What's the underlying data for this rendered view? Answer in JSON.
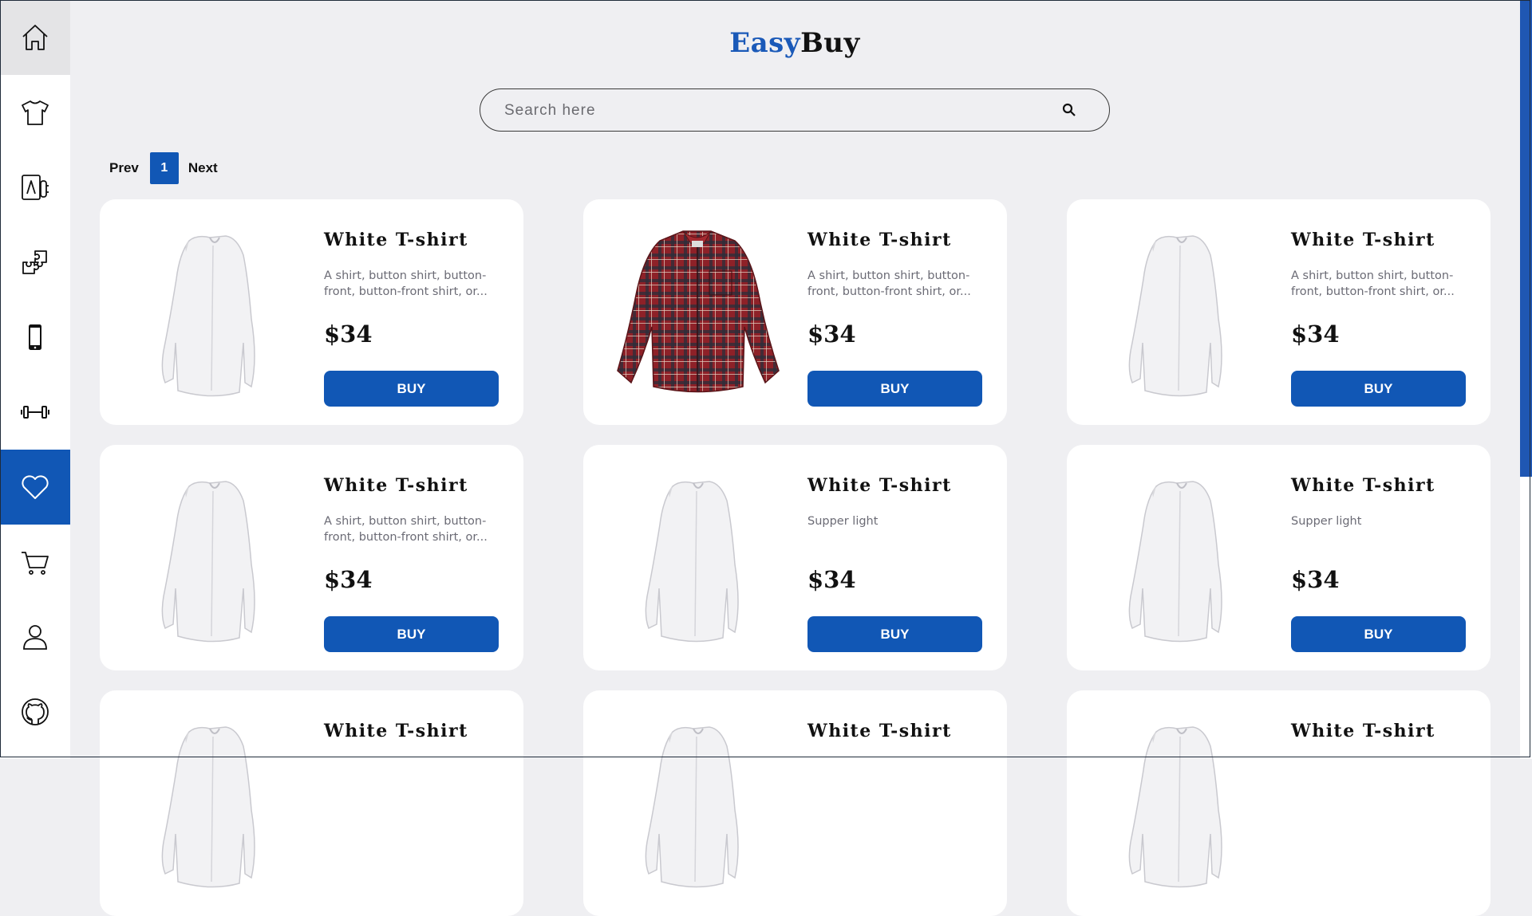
{
  "brand": {
    "part1": "Easy",
    "part2": "Buy"
  },
  "search": {
    "placeholder": "Search here"
  },
  "pagination": {
    "prev": "Prev",
    "current": "1",
    "next": "Next"
  },
  "sidebar": {
    "items": [
      {
        "icon": "home-icon",
        "state": "hover"
      },
      {
        "icon": "tshirt-icon"
      },
      {
        "icon": "appliances-icon"
      },
      {
        "icon": "puzzle-icon"
      },
      {
        "icon": "mobile-phone-icon"
      },
      {
        "icon": "dumbbell-icon"
      },
      {
        "icon": "heart-icon",
        "state": "active"
      },
      {
        "icon": "cart-icon"
      },
      {
        "icon": "user-icon"
      },
      {
        "icon": "github-icon"
      }
    ]
  },
  "products": [
    {
      "title": "White T-shirt",
      "description": "A shirt, button shirt, button-front, button-front shirt, or...",
      "price": "$34",
      "buy": "BUY",
      "image": "white-shirt"
    },
    {
      "title": "White T-shirt",
      "description": "A shirt, button shirt, button-front, button-front shirt, or...",
      "price": "$34",
      "buy": "BUY",
      "image": "plaid-shirt"
    },
    {
      "title": "White T-shirt",
      "description": "A shirt, button shirt, button-front, button-front shirt, or...",
      "price": "$34",
      "buy": "BUY",
      "image": "white-shirt"
    },
    {
      "title": "White T-shirt",
      "description": "A shirt, button shirt, button-front, button-front shirt, or...",
      "price": "$34",
      "buy": "BUY",
      "image": "white-shirt"
    },
    {
      "title": "White T-shirt",
      "description": "Supper light",
      "price": "$34",
      "buy": "BUY",
      "image": "white-shirt"
    },
    {
      "title": "White T-shirt",
      "description": "Supper light",
      "price": "$34",
      "buy": "BUY",
      "image": "white-shirt"
    },
    {
      "title": "White T-shirt",
      "description": "",
      "price": "",
      "buy": "",
      "image": "white-shirt"
    },
    {
      "title": "White T-shirt",
      "description": "",
      "price": "",
      "buy": "",
      "image": "white-shirt"
    },
    {
      "title": "White T-shirt",
      "description": "",
      "price": "",
      "buy": "",
      "image": "white-shirt"
    }
  ],
  "colors": {
    "accent": "#1157b5",
    "background": "#efeff2",
    "card": "#ffffff",
    "scrollbar": "#1f57b3"
  }
}
